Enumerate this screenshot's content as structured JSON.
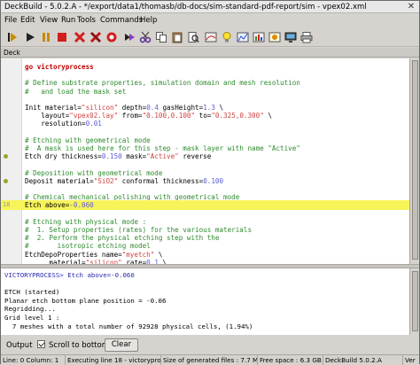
{
  "window": {
    "title": "DeckBuild - 5.0.2.A - */export/data1/thomasb/db-docs/sim-standard-pdf-report/sim - vpex02.xml",
    "close_glyph": "✕"
  },
  "menu": [
    "File",
    "Edit",
    "View",
    "Run",
    "Tools",
    "Commands",
    "Help"
  ],
  "toolbar_icons": [
    "step-icon",
    "run-icon",
    "pause-icon",
    "stop-icon",
    "kill-icon",
    "restart-icon",
    "breakpoint-icon",
    "run-to-icon",
    "cut-icon",
    "copy-icon",
    "paste-icon",
    "find-icon",
    "tonyplot-icon",
    "plot2-icon",
    "plot3-icon",
    "plot4-icon",
    "idea-icon",
    "monitor-icon",
    "printer-icon"
  ],
  "deck_label": "Deck",
  "editor_lines": [
    {
      "n": "",
      "segs": [
        {
          "c": "kw",
          "t": "go victoryprocess"
        }
      ]
    },
    {
      "n": "",
      "segs": []
    },
    {
      "n": "",
      "segs": [
        {
          "c": "cm",
          "t": "# Define substrate properties, simulation domain and mesh resolution"
        }
      ]
    },
    {
      "n": "",
      "segs": [
        {
          "c": "cm",
          "t": "#   and load the mask set"
        }
      ]
    },
    {
      "n": "",
      "segs": []
    },
    {
      "n": "",
      "segs": [
        {
          "c": "sc",
          "t": "Init material="
        },
        {
          "c": "str",
          "t": "\"silicon\""
        },
        {
          "c": "sc",
          "t": " depth="
        },
        {
          "c": "num",
          "t": "0.4"
        },
        {
          "c": "sc",
          "t": " gasHeight="
        },
        {
          "c": "num",
          "t": "1.3"
        },
        {
          "c": "sc",
          "t": " \\"
        }
      ]
    },
    {
      "n": "",
      "segs": [
        {
          "c": "sc",
          "t": "    layout="
        },
        {
          "c": "str",
          "t": "\"vpex02.lay\""
        },
        {
          "c": "sc",
          "t": " from="
        },
        {
          "c": "str",
          "t": "\"0.100,0.100\""
        },
        {
          "c": "sc",
          "t": " to="
        },
        {
          "c": "str",
          "t": "\"0.325,0.300\""
        },
        {
          "c": "sc",
          "t": " \\"
        }
      ]
    },
    {
      "n": "",
      "segs": [
        {
          "c": "sc",
          "t": "    resolution="
        },
        {
          "c": "num",
          "t": "0.01"
        }
      ]
    },
    {
      "n": "",
      "segs": []
    },
    {
      "n": "",
      "segs": [
        {
          "c": "cm",
          "t": "# Etching with geometrical mode"
        }
      ]
    },
    {
      "n": "",
      "segs": [
        {
          "c": "cm",
          "t": "#  A mask is used here for this step - mask layer with name \"Active\""
        }
      ]
    },
    {
      "n": "",
      "dot": true,
      "segs": [
        {
          "c": "sc",
          "t": "Etch dry thickness="
        },
        {
          "c": "num",
          "t": "0.150"
        },
        {
          "c": "sc",
          "t": " mask="
        },
        {
          "c": "str",
          "t": "\"Active\""
        },
        {
          "c": "sc",
          "t": " reverse"
        }
      ]
    },
    {
      "n": "",
      "segs": []
    },
    {
      "n": "",
      "segs": [
        {
          "c": "cm",
          "t": "# Deposition with geometrical mode"
        }
      ]
    },
    {
      "n": "",
      "dot": true,
      "segs": [
        {
          "c": "sc",
          "t": "Deposit material="
        },
        {
          "c": "str",
          "t": "\"SiO2\""
        },
        {
          "c": "sc",
          "t": " conformal thickness="
        },
        {
          "c": "num",
          "t": "0.100"
        }
      ]
    },
    {
      "n": "",
      "segs": []
    },
    {
      "n": "",
      "segs": [
        {
          "c": "cm",
          "t": "# Chemical mechanical polishing with geometrical mode"
        }
      ]
    },
    {
      "n": "18",
      "hl": true,
      "segs": [
        {
          "c": "sc",
          "t": "Etch above="
        },
        {
          "c": "num",
          "t": "-0.060"
        }
      ]
    },
    {
      "n": "",
      "segs": []
    },
    {
      "n": "",
      "segs": [
        {
          "c": "cm",
          "t": "# Etching with physical mode :"
        }
      ]
    },
    {
      "n": "",
      "segs": [
        {
          "c": "cm",
          "t": "#  1. Setup properties (rates) for the various materials"
        }
      ]
    },
    {
      "n": "",
      "segs": [
        {
          "c": "cm",
          "t": "#  2. Perform the physical etching step with the"
        }
      ]
    },
    {
      "n": "",
      "segs": [
        {
          "c": "cm",
          "t": "#       isotropic etching model"
        }
      ]
    },
    {
      "n": "",
      "segs": [
        {
          "c": "sc",
          "t": "EtchDepoProperties name="
        },
        {
          "c": "str",
          "t": "\"myetch\""
        },
        {
          "c": "sc",
          "t": " \\"
        }
      ]
    },
    {
      "n": "",
      "segs": [
        {
          "c": "sc",
          "t": "      material="
        },
        {
          "c": "str",
          "t": "\"silicon\""
        },
        {
          "c": "sc",
          "t": " rate="
        },
        {
          "c": "num",
          "t": "0.1"
        },
        {
          "c": "sc",
          "t": " \\"
        }
      ]
    }
  ],
  "output_lines": [
    {
      "blue": true,
      "t": "VICTORYPROCESS> Etch above=-0.060"
    },
    {
      "blue": false,
      "t": ""
    },
    {
      "blue": false,
      "t": "ETCH (started)"
    },
    {
      "blue": false,
      "t": "Planar etch bottom plane position = -0.06"
    },
    {
      "blue": false,
      "t": "Regridding..."
    },
    {
      "blue": false,
      "t": "Grid level 1 :"
    },
    {
      "blue": false,
      "t": "  7 meshes with a total number of 92928 physical cells, (1.94%)"
    }
  ],
  "output_bar": {
    "label": "Output",
    "scroll_label": "Scroll to bottom",
    "scroll_checked": true,
    "clear_label": "Clear"
  },
  "status": {
    "position": "Line: 0 Column: 1",
    "executing": "Executing line 18 - victorypro",
    "generated": "Size of generated files : 7.7 MI",
    "free": "Free space : 6.3 GB",
    "version": "DeckBuild 5.0.2.A",
    "tail": "Ver"
  }
}
